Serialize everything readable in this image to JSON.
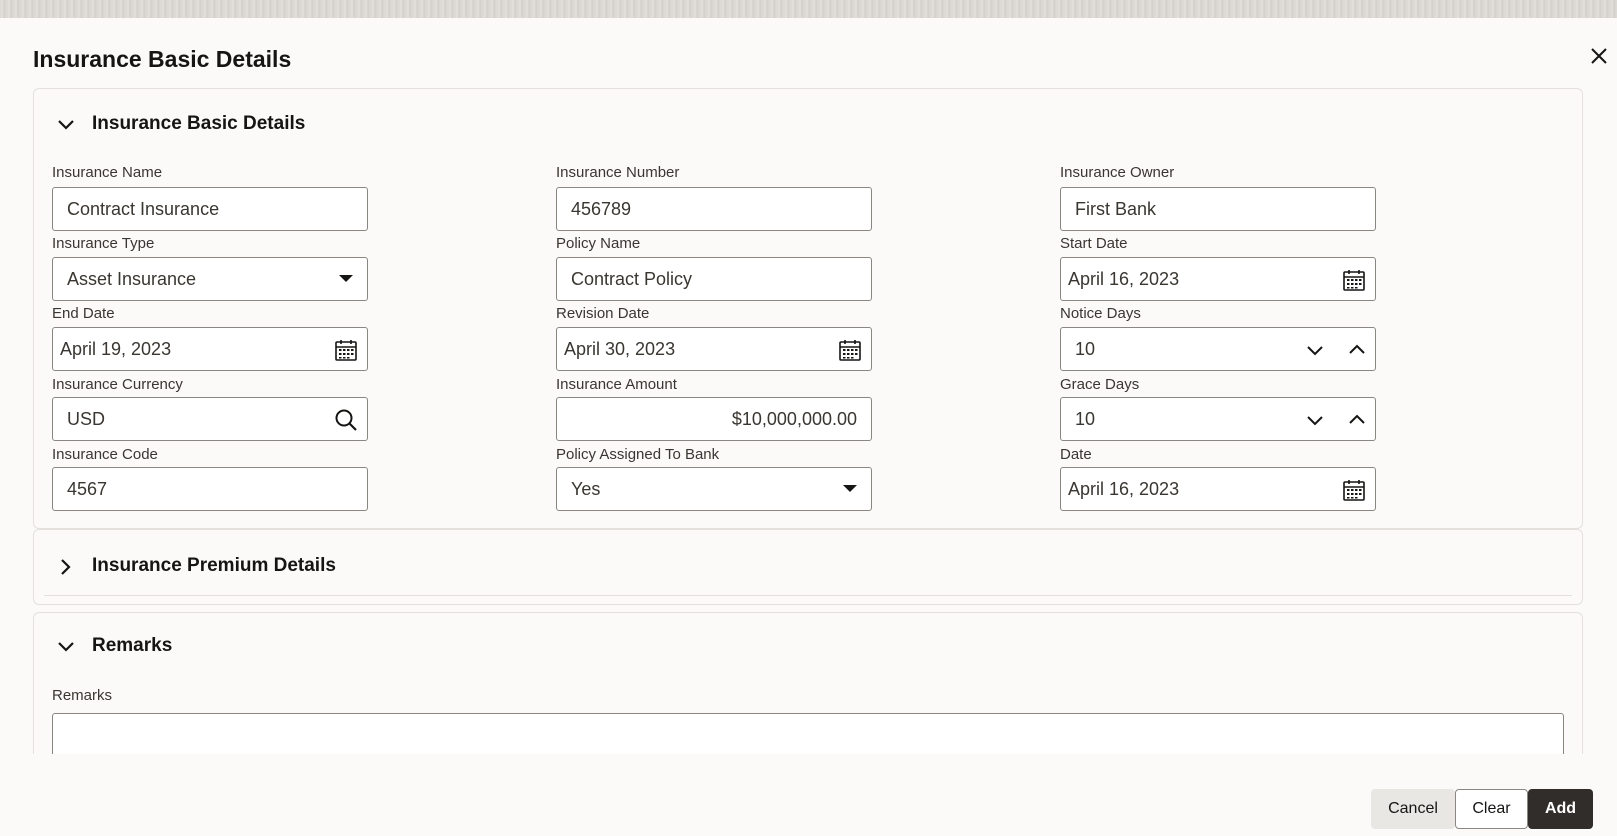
{
  "dialog": {
    "title": "Insurance Basic Details",
    "close_icon": "close-icon"
  },
  "basic_section": {
    "title": "Insurance Basic Details",
    "expanded": true,
    "fields": {
      "insurance_name": {
        "label": "Insurance Name",
        "value": "Contract Insurance"
      },
      "insurance_number": {
        "label": "Insurance Number",
        "value": "456789"
      },
      "insurance_owner": {
        "label": "Insurance Owner",
        "value": "First Bank"
      },
      "insurance_type": {
        "label": "Insurance Type",
        "value": "Asset Insurance"
      },
      "policy_name": {
        "label": "Policy Name",
        "value": "Contract Policy"
      },
      "start_date": {
        "label": "Start Date",
        "value": "April 16, 2023"
      },
      "end_date": {
        "label": "End Date",
        "value": "April 19, 2023"
      },
      "revision_date": {
        "label": "Revision Date",
        "value": "April 30, 2023"
      },
      "notice_days": {
        "label": "Notice Days",
        "value": "10"
      },
      "insurance_currency": {
        "label": "Insurance Currency",
        "value": "USD"
      },
      "insurance_amount": {
        "label": "Insurance Amount",
        "value": "$10,000,000.00"
      },
      "grace_days": {
        "label": "Grace Days",
        "value": "10"
      },
      "insurance_code": {
        "label": "Insurance Code",
        "value": "4567"
      },
      "policy_assigned": {
        "label": "Policy Assigned To Bank",
        "value": "Yes"
      },
      "date": {
        "label": "Date",
        "value": "April 16, 2023"
      }
    }
  },
  "premium_section": {
    "title": "Insurance Premium Details",
    "expanded": false
  },
  "remarks_section": {
    "title": "Remarks",
    "expanded": true,
    "field_label": "Remarks",
    "value": ""
  },
  "footer": {
    "cancel_label": "Cancel",
    "clear_label": "Clear",
    "add_label": "Add"
  },
  "colors": {
    "primary_button": "#312d2a",
    "border": "#8a8782",
    "background": "#fbfaf9"
  }
}
